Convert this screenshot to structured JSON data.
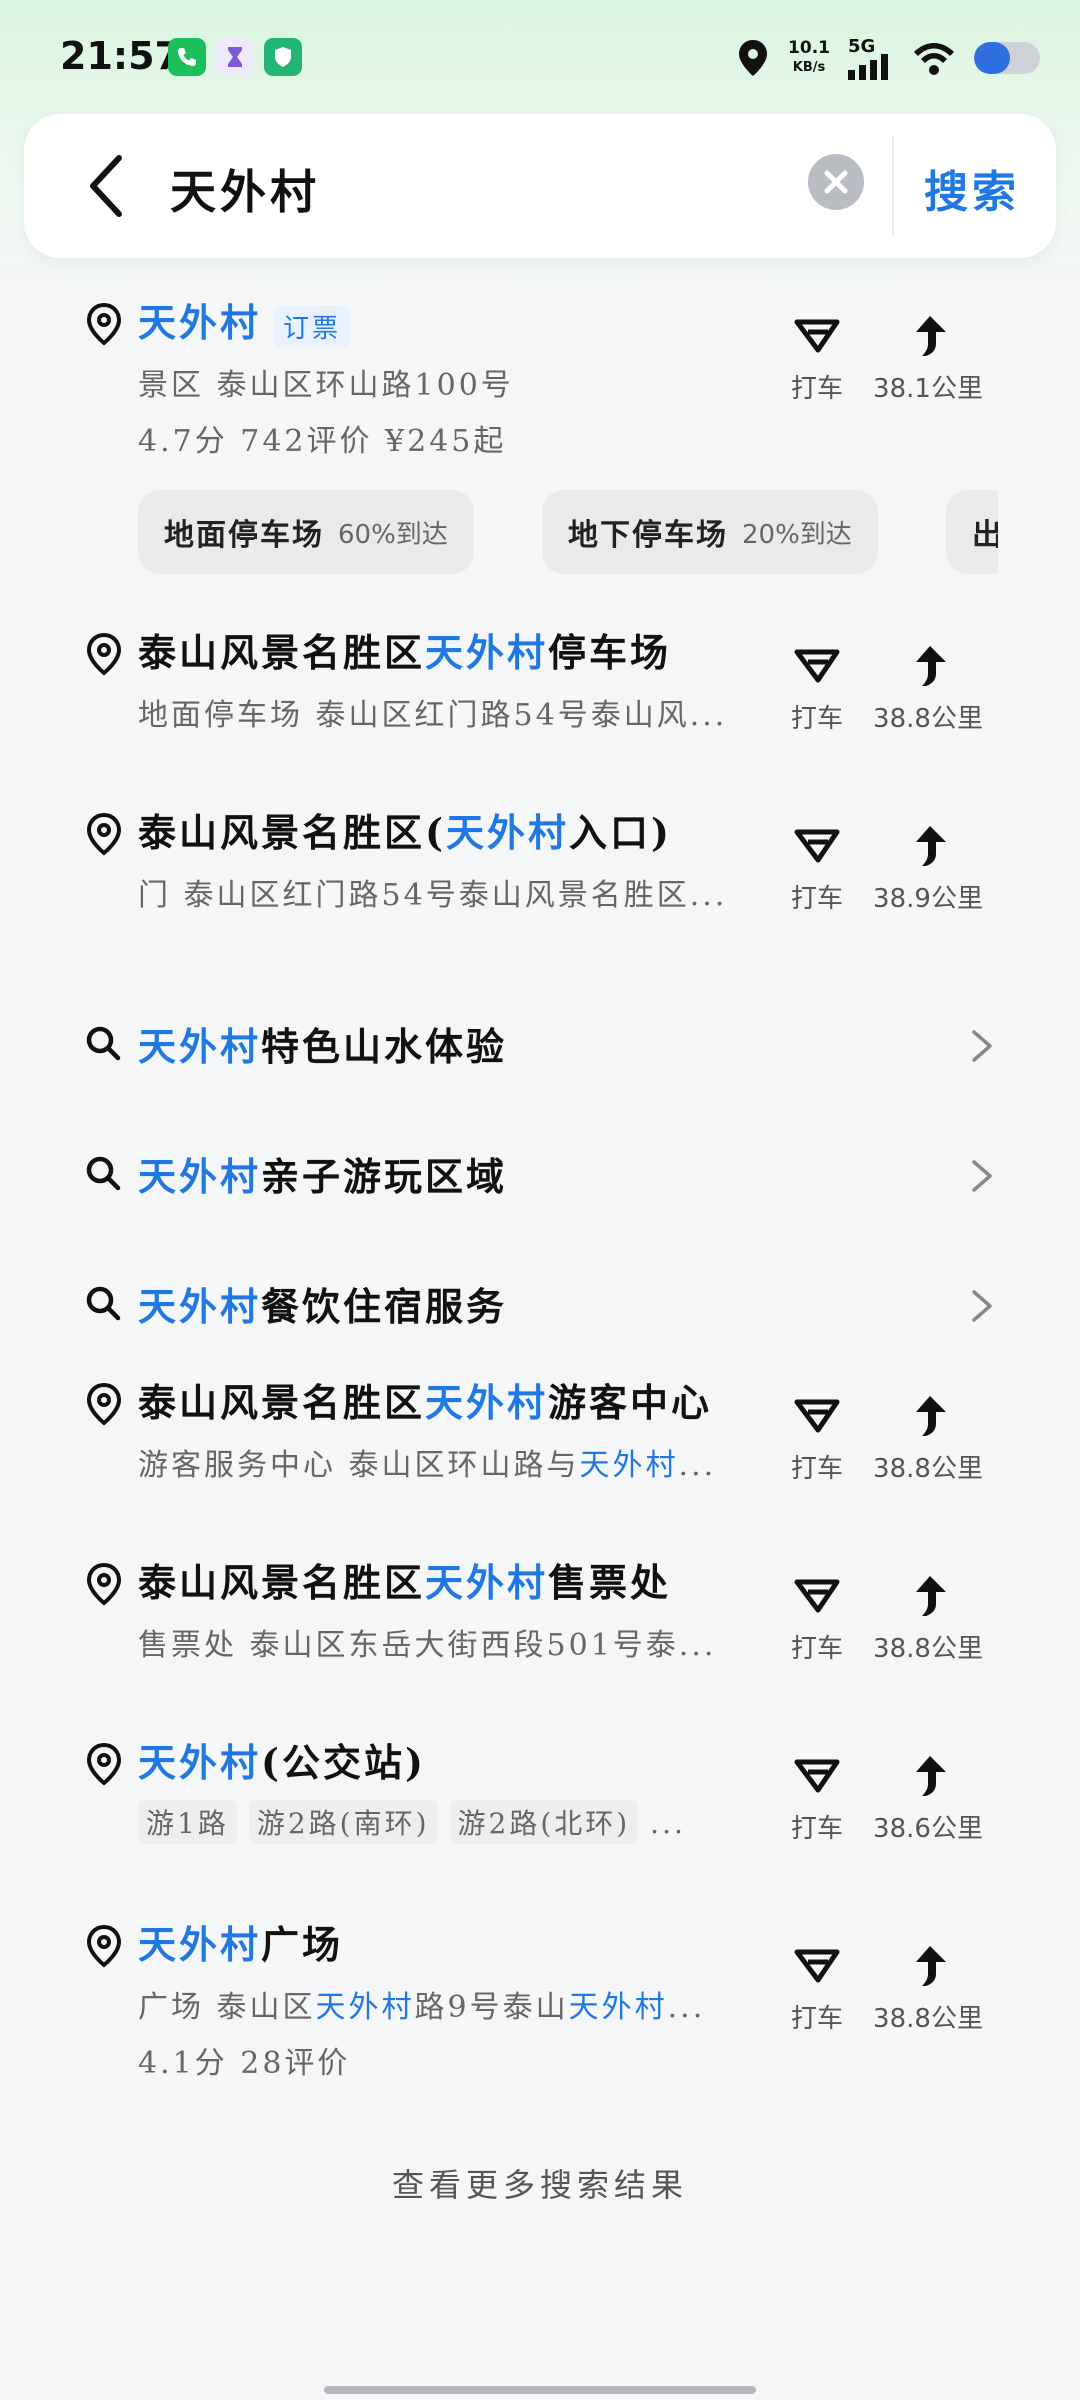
{
  "status_bar": {
    "time": "21:57",
    "speed_value": "10.1",
    "speed_unit": "KB/s",
    "network": "5G",
    "battery_percent": 55,
    "app_icons": [
      "phone-app-icon",
      "hourglass-app-icon",
      "shield-app-icon"
    ]
  },
  "search": {
    "query": "天外村",
    "button_label": "搜索"
  },
  "colors": {
    "accent": "#1f78e4",
    "bg": "#f5f6f8"
  },
  "results": [
    {
      "type": "place",
      "title_parts": [
        {
          "t": "天外村",
          "hl": true
        }
      ],
      "badge": "订票",
      "line2": "景区  泰山区环山路100号",
      "line3": "4.7分  742评价  ¥245起",
      "taxi_label": "打车",
      "distance": "38.1公里",
      "chips": [
        {
          "name": "地面停车场",
          "pct": "60%到达"
        },
        {
          "name": "地下停车场",
          "pct": "20%到达"
        },
        {
          "name": "出",
          "pct": ""
        }
      ]
    },
    {
      "type": "place",
      "title_parts": [
        {
          "t": "泰山风景名胜区",
          "hl": false
        },
        {
          "t": "天外村",
          "hl": true
        },
        {
          "t": "停车场",
          "hl": false
        }
      ],
      "line2_parts": [
        {
          "t": "地面停车场  泰山区红门路54号泰山风...",
          "hl": false
        }
      ],
      "taxi_label": "打车",
      "distance": "38.8公里"
    },
    {
      "type": "place",
      "title_parts": [
        {
          "t": "泰山风景名胜区(",
          "hl": false
        },
        {
          "t": "天外村",
          "hl": true
        },
        {
          "t": "入口)",
          "hl": false
        }
      ],
      "line2_parts": [
        {
          "t": "门  泰山区红门路54号泰山风景名胜区...",
          "hl": false
        }
      ],
      "taxi_label": "打车",
      "distance": "38.9公里"
    },
    {
      "type": "suggestion",
      "title_parts": [
        {
          "t": "天外村",
          "hl": true
        },
        {
          "t": "特色山水体验",
          "hl": false
        }
      ]
    },
    {
      "type": "suggestion",
      "title_parts": [
        {
          "t": "天外村",
          "hl": true
        },
        {
          "t": "亲子游玩区域",
          "hl": false
        }
      ]
    },
    {
      "type": "suggestion",
      "title_parts": [
        {
          "t": "天外村",
          "hl": true
        },
        {
          "t": "餐饮住宿服务",
          "hl": false
        }
      ]
    },
    {
      "type": "place",
      "title_parts": [
        {
          "t": "泰山风景名胜区",
          "hl": false
        },
        {
          "t": "天外村",
          "hl": true
        },
        {
          "t": "游客中心",
          "hl": false
        }
      ],
      "line2_parts": [
        {
          "t": "游客服务中心  泰山区环山路与",
          "hl": false
        },
        {
          "t": "天外村",
          "hl": true
        },
        {
          "t": "...",
          "hl": false
        }
      ],
      "taxi_label": "打车",
      "distance": "38.8公里"
    },
    {
      "type": "place",
      "title_parts": [
        {
          "t": "泰山风景名胜区",
          "hl": false
        },
        {
          "t": "天外村",
          "hl": true
        },
        {
          "t": "售票处",
          "hl": false
        }
      ],
      "line2_parts": [
        {
          "t": "售票处  泰山区东岳大街西段501号泰...",
          "hl": false
        }
      ],
      "taxi_label": "打车",
      "distance": "38.8公里"
    },
    {
      "type": "place",
      "title_parts": [
        {
          "t": "天外村",
          "hl": true
        },
        {
          "t": "(公交站)",
          "hl": false
        }
      ],
      "tags": [
        "游1路",
        "游2路(南环)",
        "游2路(北环)",
        "..."
      ],
      "taxi_label": "打车",
      "distance": "38.6公里"
    },
    {
      "type": "place",
      "title_parts": [
        {
          "t": "天外村",
          "hl": true
        },
        {
          "t": "广场",
          "hl": false
        }
      ],
      "line2_parts": [
        {
          "t": "广场  泰山区",
          "hl": false
        },
        {
          "t": "天外村",
          "hl": true
        },
        {
          "t": "路9号泰山",
          "hl": false
        },
        {
          "t": "天外村",
          "hl": true
        },
        {
          "t": "...",
          "hl": false
        }
      ],
      "line3": "4.1分  28评价",
      "taxi_label": "打车",
      "distance": "38.8公里"
    }
  ],
  "more_label": "查看更多搜索结果"
}
